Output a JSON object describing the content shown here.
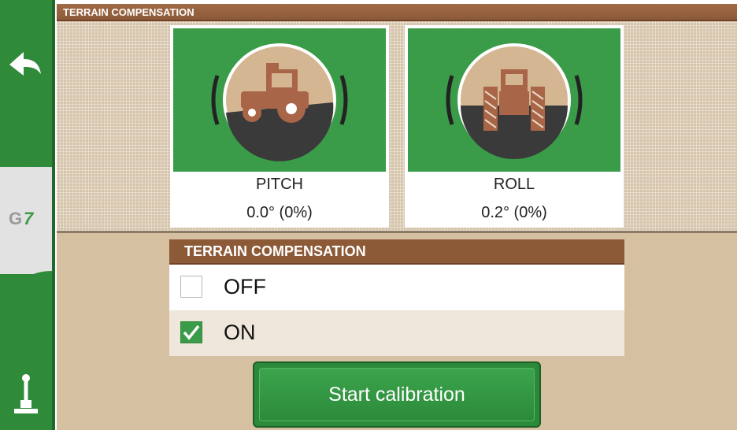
{
  "header": {
    "title": "TERRAIN COMPENSATION"
  },
  "sidebar": {
    "back_icon": "back-arrow-icon",
    "logo_text": "G7",
    "joystick_icon": "joystick-icon"
  },
  "cards": [
    {
      "title": "PITCH",
      "value": "0.0° (0%)",
      "icon": "tractor-side-view-icon"
    },
    {
      "title": "ROLL",
      "value": "0.2° (0%)",
      "icon": "tractor-rear-view-icon"
    }
  ],
  "terrain_comp": {
    "title": "TERRAIN COMPENSATION",
    "options": [
      {
        "label": "OFF",
        "checked": false
      },
      {
        "label": "ON",
        "checked": true
      }
    ]
  },
  "start_button": {
    "label": "Start calibration"
  },
  "colors": {
    "green": "#3a9b48",
    "brown": "#8d5a38",
    "tan": "#d6c0a2"
  }
}
